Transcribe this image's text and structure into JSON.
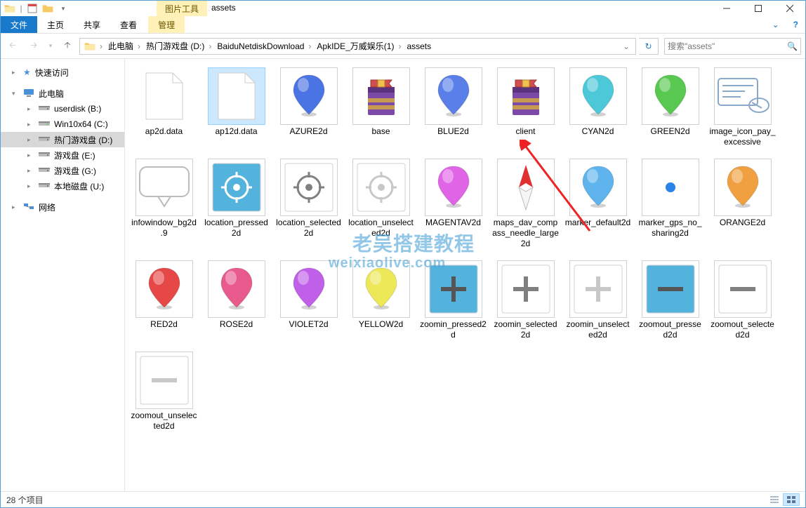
{
  "titlebar": {
    "tool_tab": "图片工具",
    "window_title": "assets"
  },
  "ribbon": {
    "file": "文件",
    "tabs": [
      "主页",
      "共享",
      "查看"
    ],
    "tool_sub": "管理"
  },
  "breadcrumbs": {
    "segments": [
      "此电脑",
      "热门游戏盘 (D:)",
      "BaiduNetdiskDownload",
      "ApkIDE_万威娱乐(1)",
      "assets"
    ]
  },
  "search": {
    "placeholder": "搜索\"assets\""
  },
  "sidebar": {
    "quick_access": "快速访问",
    "this_pc": "此电脑",
    "drives": [
      {
        "label": "userdisk (B:)"
      },
      {
        "label": "Win10x64 (C:)"
      },
      {
        "label": "热门游戏盘 (D:)",
        "selected": true
      },
      {
        "label": "游戏盘 (E:)"
      },
      {
        "label": "游戏盘 (G:)"
      },
      {
        "label": "本地磁盘 (U:)"
      }
    ],
    "network": "网络"
  },
  "items": [
    {
      "name": "ap2d.data",
      "kind": "blank"
    },
    {
      "name": "ap12d.data",
      "kind": "blank",
      "selected": true
    },
    {
      "name": "AZURE2d",
      "kind": "pin",
      "color": "#4a74e3",
      "framed": true
    },
    {
      "name": "base",
      "kind": "rar",
      "framed": true
    },
    {
      "name": "BLUE2d",
      "kind": "pin",
      "color": "#5a7fe8",
      "framed": true
    },
    {
      "name": "client",
      "kind": "rar",
      "framed": true
    },
    {
      "name": "CYAN2d",
      "kind": "pin",
      "color": "#4cc8d8",
      "framed": true
    },
    {
      "name": "GREEN2d",
      "kind": "pin",
      "color": "#58c850",
      "framed": true
    },
    {
      "name": "image_icon_pay_excessive",
      "kind": "pay",
      "framed": true
    },
    {
      "name": "infowindow_bg2d.9",
      "kind": "infowin",
      "framed": true
    },
    {
      "name": "location_pressed2d",
      "kind": "loc",
      "bg": "#54b3dc",
      "fg": "#ffffff",
      "framed": true
    },
    {
      "name": "location_selected2d",
      "kind": "loc",
      "bg": "#ffffff",
      "fg": "#808080",
      "framed": true
    },
    {
      "name": "location_unselected2d",
      "kind": "loc",
      "bg": "#ffffff",
      "fg": "#c8c8c8",
      "framed": true
    },
    {
      "name": "MAGENTAV2d",
      "kind": "pin",
      "color": "#e065e6",
      "framed": true
    },
    {
      "name": "maps_dav_compass_needle_large2d",
      "kind": "compass",
      "framed": true
    },
    {
      "name": "marker_default2d",
      "kind": "pin",
      "color": "#5fb4ee",
      "framed": true
    },
    {
      "name": "marker_gps_no_sharing2d",
      "kind": "dot",
      "color": "#2a83e6",
      "framed": true
    },
    {
      "name": "ORANGE2d",
      "kind": "pin",
      "color": "#f0a040",
      "framed": true
    },
    {
      "name": "RED2d",
      "kind": "pin",
      "color": "#e64848",
      "framed": true
    },
    {
      "name": "ROSE2d",
      "kind": "pin",
      "color": "#e85a8c",
      "framed": true
    },
    {
      "name": "VIOLET2d",
      "kind": "pin",
      "color": "#c060e8",
      "framed": true
    },
    {
      "name": "YELLOW2d",
      "kind": "pin",
      "color": "#ece858",
      "framed": true
    },
    {
      "name": "zoomin_pressed2d",
      "kind": "pm",
      "sign": "+",
      "bg": "#54b3dc",
      "fg": "#555",
      "framed": true
    },
    {
      "name": "zoomin_selected2d",
      "kind": "pm",
      "sign": "+",
      "bg": "#ffffff",
      "fg": "#808080",
      "framed": true
    },
    {
      "name": "zoomin_unselected2d",
      "kind": "pm",
      "sign": "+",
      "bg": "#ffffff",
      "fg": "#c8c8c8",
      "framed": true
    },
    {
      "name": "zoomout_pressed2d",
      "kind": "pm",
      "sign": "−",
      "bg": "#54b3dc",
      "fg": "#555",
      "framed": true
    },
    {
      "name": "zoomout_selected2d",
      "kind": "pm",
      "sign": "−",
      "bg": "#ffffff",
      "fg": "#808080",
      "framed": true
    },
    {
      "name": "zoomout_unselected2d",
      "kind": "pm",
      "sign": "−",
      "bg": "#ffffff",
      "fg": "#c8c8c8",
      "framed": true
    }
  ],
  "statusbar": {
    "count_text": "28 个项目"
  },
  "watermark": {
    "line1": "老吴搭建教程",
    "line2": "weixiaolive.com"
  }
}
